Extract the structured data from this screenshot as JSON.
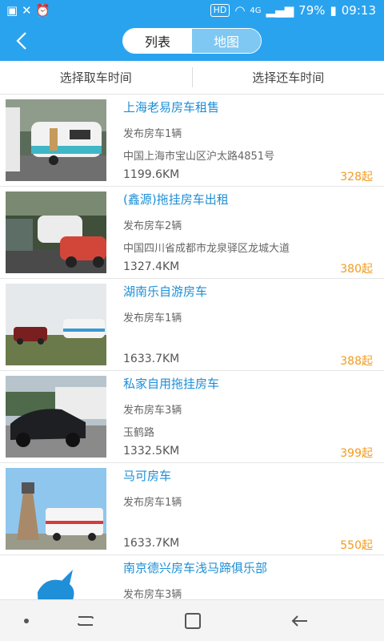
{
  "status_bar": {
    "battery": "79%",
    "time": "09:13",
    "network": "4G",
    "hd_badge": "HD"
  },
  "header": {
    "tabs": [
      {
        "label": "列表"
      },
      {
        "label": "地图"
      }
    ]
  },
  "filters": {
    "pickup_label": "选择取车时间",
    "return_label": "选择还车时间"
  },
  "listings": [
    {
      "title": "上海老易房车租售",
      "count": "发布房车1辆",
      "address": "中国上海市宝山区沪太路4851号",
      "distance": "1199.6KM",
      "price": "328起"
    },
    {
      "title": "(鑫源)拖挂房车出租",
      "count": "发布房车2辆",
      "address": "中国四川省成都市龙泉驿区龙城大道",
      "distance": "1327.4KM",
      "price": "380起"
    },
    {
      "title": "湖南乐自游房车",
      "count": "发布房车1辆",
      "address": "",
      "distance": "1633.7KM",
      "price": "388起"
    },
    {
      "title": "私家自用拖挂房车",
      "count": "发布房车3辆",
      "address": "玉鹤路",
      "distance": "1332.5KM",
      "price": "399起"
    },
    {
      "title": "马可房车",
      "count": "发布房车1辆",
      "address": "",
      "distance": "1633.7KM",
      "price": "550起"
    },
    {
      "title": "南京德兴房车浅马蹄俱乐部",
      "count": "发布房车3辆",
      "address": "",
      "distance": "",
      "price": ""
    }
  ],
  "colors": {
    "primary": "#2aa3ef",
    "title_blue": "#1d8fd6",
    "price_orange": "#f39a1e"
  }
}
